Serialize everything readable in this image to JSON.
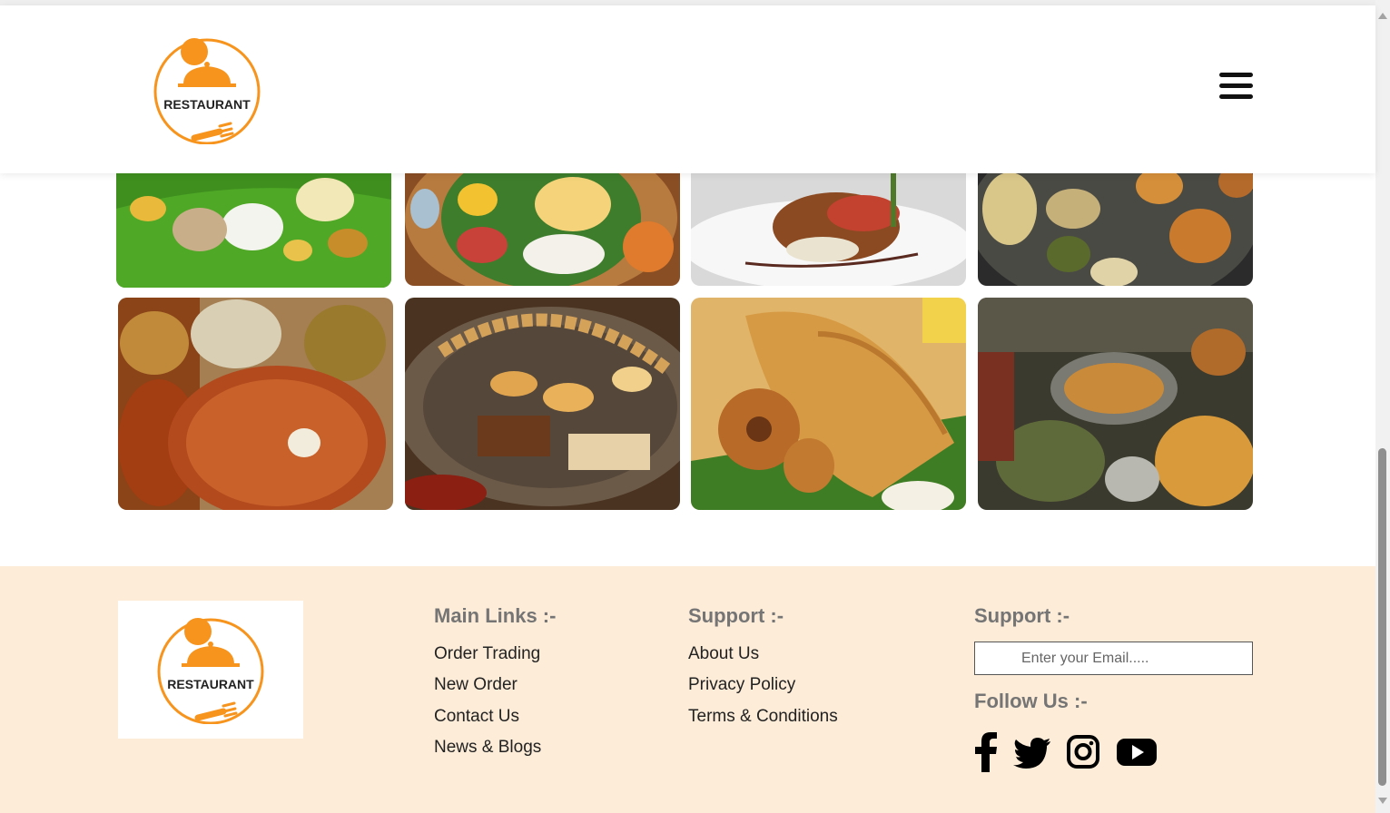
{
  "brand": {
    "logo_text": "RESTAURANT",
    "accent_color": "#f7941d"
  },
  "header": {
    "menu_icon": "hamburger-menu-icon"
  },
  "gallery": {
    "tiles": [
      {
        "name": "kerala-sadhya-banana-leaf"
      },
      {
        "name": "south-indian-thali"
      },
      {
        "name": "grilled-fish-plate"
      },
      {
        "name": "north-indian-thali"
      },
      {
        "name": "paratha-platter"
      },
      {
        "name": "tawa-street-food"
      },
      {
        "name": "masala-dosa-vada"
      },
      {
        "name": "street-food-stall"
      }
    ]
  },
  "footer": {
    "main_links": {
      "heading": "Main Links :-",
      "items": [
        "Order Trading",
        "New Order",
        "Contact Us",
        "News & Blogs"
      ]
    },
    "support": {
      "heading": "Support :-",
      "items": [
        "About Us",
        "Privacy Policy",
        "Terms & Conditions"
      ]
    },
    "subscribe": {
      "heading": "Support :-",
      "email_placeholder": "Enter your Email....."
    },
    "follow": {
      "heading": "Follow Us :-",
      "icons": [
        "facebook-icon",
        "twitter-icon",
        "instagram-icon",
        "youtube-icon"
      ]
    }
  },
  "colors": {
    "footer_bg": "#fdecd8",
    "heading": "#757575",
    "link": "#222222"
  }
}
